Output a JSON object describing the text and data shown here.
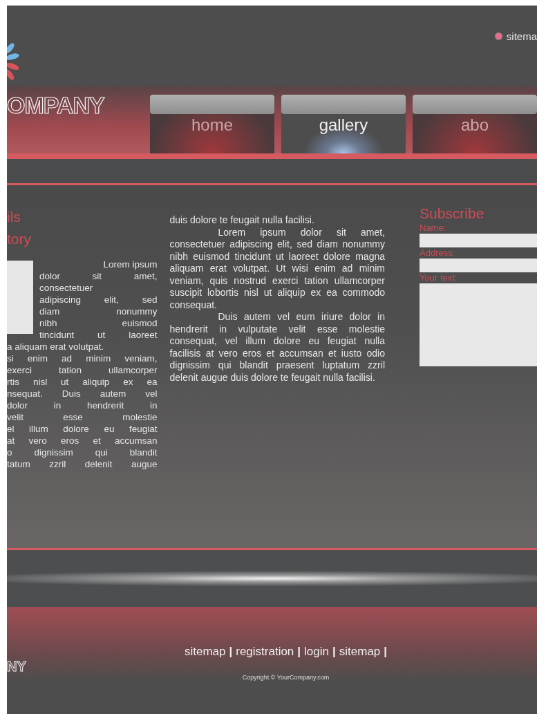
{
  "header": {
    "top_link": "sitema",
    "logo_text": "OMPANY"
  },
  "nav": [
    {
      "label": "home",
      "selected": false
    },
    {
      "label": "gallery",
      "selected": true
    },
    {
      "label": "abo",
      "selected": false
    }
  ],
  "left_column": {
    "headings": [
      "ils",
      "tory"
    ],
    "lines_beside_photo": [
      {
        "text": "Lorem ipsum",
        "kind": "right"
      },
      {
        "text": "dolor sit amet,",
        "kind": "justify"
      },
      {
        "text": "consectetuer",
        "kind": "justify"
      },
      {
        "text": "adipiscing elit, sed",
        "kind": "justify"
      },
      {
        "text": "diam nonummy",
        "kind": "justify"
      },
      {
        "text": "nibh euismod",
        "kind": "justify"
      },
      {
        "text": "tincidunt ut laoreet",
        "kind": "justify"
      }
    ],
    "lines": [
      {
        "text": "a aliquam erat volutpat.",
        "kind": "left"
      },
      {
        "text": "si enim ad minim veniam,",
        "kind": "justify"
      },
      {
        "text": "exerci tation ullamcorper",
        "kind": "justify"
      },
      {
        "text": "rtis nisl ut aliquip ex ea",
        "kind": "justify"
      },
      {
        "text": "nsequat. Duis autem vel",
        "kind": "justify"
      },
      {
        "text": "dolor in hendrerit in",
        "kind": "justify"
      },
      {
        "text": "velit esse molestie",
        "kind": "justify"
      },
      {
        "text": "el illum dolore eu feugiat",
        "kind": "justify"
      },
      {
        "text": "at vero eros et accumsan",
        "kind": "justify"
      },
      {
        "text": "o dignissim qui blandit",
        "kind": "justify"
      },
      {
        "text": "tatum zzril delenit augue",
        "kind": "justify"
      }
    ]
  },
  "middle_column": {
    "paragraphs": [
      {
        "text": "duis dolore te feugait nulla facilisi.",
        "indented": false
      },
      {
        "text": "Lorem ipsum dolor sit amet, consectetuer adipiscing elit, sed diam nonummy nibh euismod tincidunt ut laoreet dolore magna aliquam erat volutpat. Ut wisi enim ad minim veniam, quis nostrud exerci tation ullamcorper suscipit lobortis nisl ut aliquip ex ea commodo consequat.",
        "indented": true
      },
      {
        "text": "Duis autem vel eum iriure dolor in hendrerit in vulputate velit esse molestie consequat, vel illum dolore eu feugiat nulla facilisis at vero eros et accumsan et iusto odio dignissim qui blandit praesent luptatum zzril delenit augue duis dolore te feugait nulla facilisi.",
        "indented": true
      }
    ]
  },
  "subscribe": {
    "title": "Subscribe",
    "fields": [
      {
        "label": "Name:",
        "kind": "input"
      },
      {
        "label": "Address:",
        "kind": "input"
      },
      {
        "label": "Your text:",
        "kind": "textarea"
      }
    ]
  },
  "footer": {
    "logo_text": "NY",
    "links": [
      "sitemap",
      "registration",
      "login",
      "sitemap"
    ],
    "separator": "|",
    "copyright": "Copyright © YourCompany.com"
  }
}
